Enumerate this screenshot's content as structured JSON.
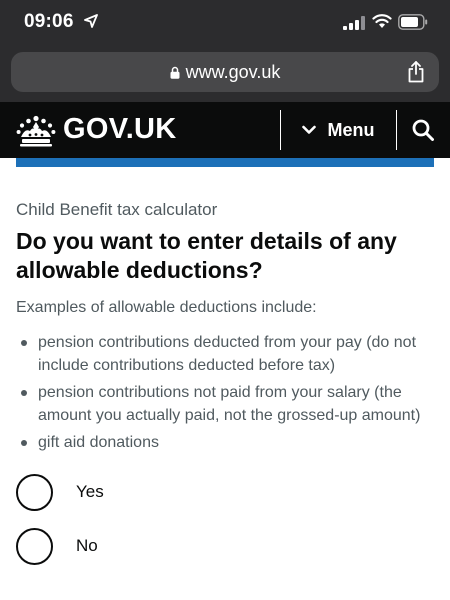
{
  "status_bar": {
    "time": "09:06",
    "icons": [
      "location-arrow-icon",
      "cellular-signal-icon",
      "wifi-icon",
      "battery-icon"
    ]
  },
  "browser": {
    "url": "www.gov.uk",
    "icons": [
      "lock-icon",
      "share-icon"
    ]
  },
  "header": {
    "logo_text": "GOV.UK",
    "menu_label": "Menu",
    "icons": [
      "crown-icon",
      "chevron-down-icon",
      "search-icon"
    ]
  },
  "page": {
    "caption": "Child Benefit tax calculator",
    "heading": "Do you want to enter details of any allowable deductions?",
    "hint": "Examples of allowable deductions include:",
    "bullets": [
      "pension contributions deducted from your pay (do not include contributions deducted before tax)",
      "pension contributions not paid from your salary (the amount you actually paid, not the grossed-up amount)",
      "gift aid donations"
    ],
    "options": [
      "Yes",
      "No"
    ]
  },
  "colors": {
    "header_bg": "#0b0c0c",
    "accent_blue": "#1d70b8",
    "text": "#0b0c0c",
    "secondary_text": "#505a5f",
    "browser_chrome": "#2c2c2e",
    "url_field": "#48484a"
  }
}
